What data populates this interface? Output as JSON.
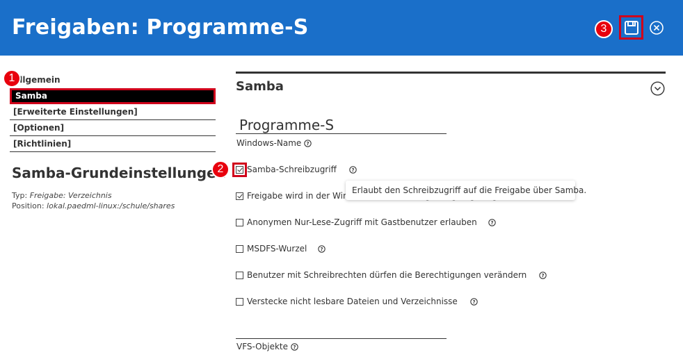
{
  "header": {
    "title": "Freigaben: Programme-S",
    "save_icon": "floppy-disk-icon",
    "close_icon": "close-circle-icon",
    "bg_color": "#1a6fc9"
  },
  "markers": {
    "m1": "1",
    "m2": "2",
    "m3": "3",
    "color": "#e8000d"
  },
  "nav": {
    "items": [
      {
        "label": "Allgemein"
      },
      {
        "label": "Samba"
      },
      {
        "label": "[Erweiterte Einstellungen]"
      },
      {
        "label": "[Optionen]"
      },
      {
        "label": "[Richtlinien]"
      }
    ]
  },
  "sidebar": {
    "section_title": "Samba-Grundeinstellungen",
    "type_label": "Typ: ",
    "type_value": "Freigabe: Verzeichnis",
    "position_label": "Position: ",
    "position_value": "lokal.paedml-linux:/schule/shares"
  },
  "main": {
    "heading": "Samba",
    "windows_name_value": "Programme-S",
    "windows_name_label": "Windows-Name",
    "vfs_value": "",
    "vfs_label": "VFS-Objekte",
    "checkboxes": [
      {
        "label": "Samba-Schreibzugriff",
        "checked": true
      },
      {
        "label": "Freigabe wird in der Windows-Netzwerkumgebung angezeigt",
        "checked": true
      },
      {
        "label": "Anonymen Nur-Lese-Zugriff mit Gastbenutzer erlauben",
        "checked": false
      },
      {
        "label": "MSDFS-Wurzel",
        "checked": false
      },
      {
        "label": "Benutzer mit Schreibrechten dürfen die Berechtigungen verändern",
        "checked": false
      },
      {
        "label": "Verstecke nicht lesbare Dateien und Verzeichnisse",
        "checked": false
      }
    ],
    "tooltip": "Erlaubt den Schreibzugriff auf die Freigabe über Samba."
  }
}
